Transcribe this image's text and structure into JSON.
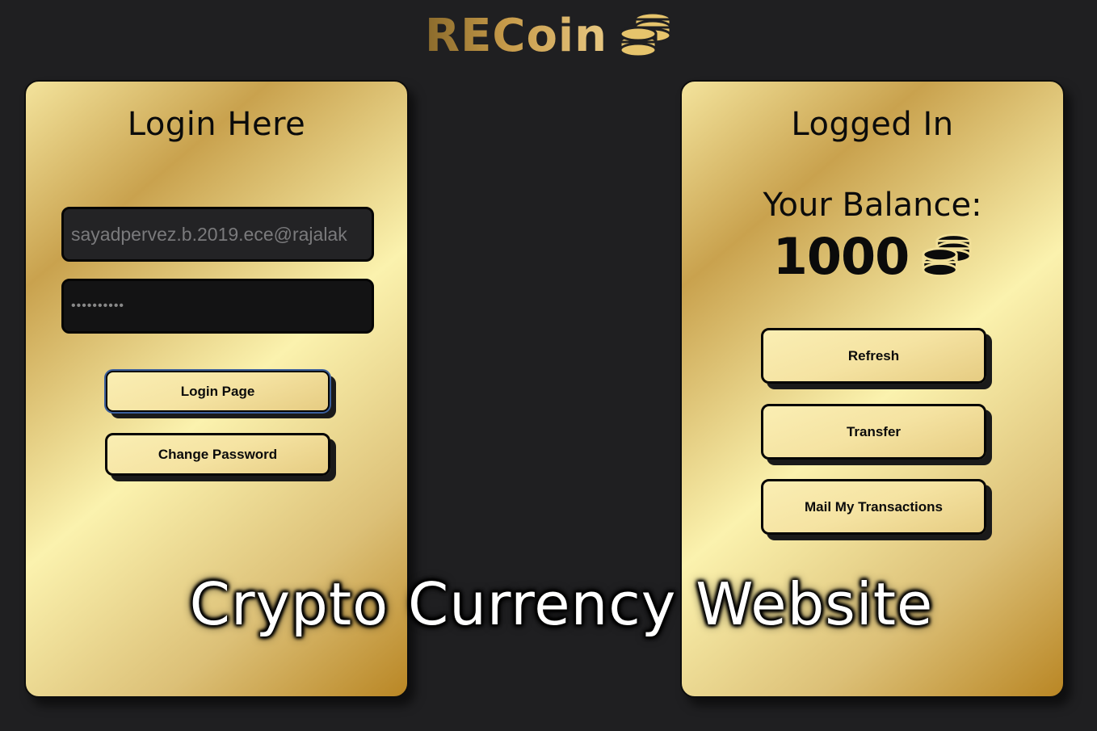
{
  "brand": {
    "name": "RECoin",
    "icon": "coins-stack-icon",
    "gold_color": "#c79b4a"
  },
  "login_card": {
    "title": "Login Here",
    "email_value": "sayadpervez.b.2019.ece@rajalak",
    "password_value": "••••••••••",
    "login_button": "Login Page",
    "change_password_button": "Change Password"
  },
  "account_card": {
    "title": "Logged In",
    "balance_label": "Your Balance:",
    "balance_value": "1000",
    "balance_icon": "coins-stack-icon",
    "refresh_button": "Refresh",
    "transfer_button": "Transfer",
    "mail_button": "Mail My Transactions"
  },
  "overlay_caption": "Crypto Currency Website",
  "colors": {
    "background": "#1f1f21",
    "card_gold_light": "#fbf2ae",
    "card_gold_dark": "#b98624",
    "input_bg": "#232325",
    "text_dark": "#0b0b0b"
  }
}
